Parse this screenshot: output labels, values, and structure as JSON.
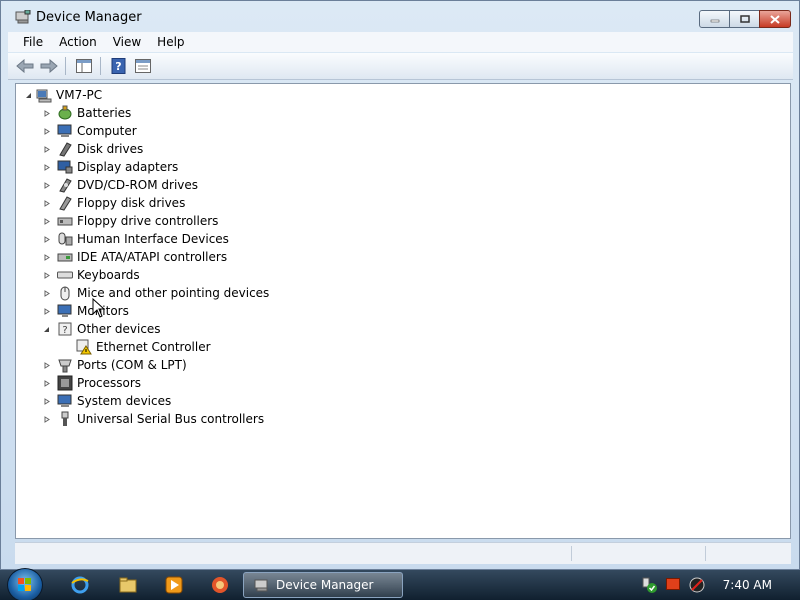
{
  "window": {
    "title": "Device Manager"
  },
  "menu": [
    "File",
    "Action",
    "View",
    "Help"
  ],
  "toolbar": {
    "buttons": [
      "back-arrow-icon",
      "forward-arrow-icon",
      "show-hide-console-tree-icon",
      "help-icon",
      "properties-icon"
    ]
  },
  "tree": {
    "root": "VM7-PC",
    "items": [
      {
        "label": "Batteries",
        "icon": "battery-icon",
        "state": "collapsed"
      },
      {
        "label": "Computer",
        "icon": "computer-icon",
        "state": "collapsed"
      },
      {
        "label": "Disk drives",
        "icon": "disk-drive-icon",
        "state": "collapsed"
      },
      {
        "label": "Display adapters",
        "icon": "display-adapter-icon",
        "state": "collapsed"
      },
      {
        "label": "DVD/CD-ROM drives",
        "icon": "dvd-drive-icon",
        "state": "collapsed"
      },
      {
        "label": "Floppy disk drives",
        "icon": "floppy-drive-icon",
        "state": "collapsed"
      },
      {
        "label": "Floppy drive controllers",
        "icon": "floppy-controller-icon",
        "state": "collapsed"
      },
      {
        "label": "Human Interface Devices",
        "icon": "hid-icon",
        "state": "collapsed"
      },
      {
        "label": "IDE ATA/ATAPI controllers",
        "icon": "ide-controller-icon",
        "state": "collapsed"
      },
      {
        "label": "Keyboards",
        "icon": "keyboard-icon",
        "state": "collapsed"
      },
      {
        "label": "Mice and other pointing devices",
        "icon": "mouse-icon",
        "state": "collapsed"
      },
      {
        "label": "Monitors",
        "icon": "monitor-icon",
        "state": "collapsed"
      },
      {
        "label": "Other devices",
        "icon": "unknown-device-icon",
        "state": "expanded"
      },
      {
        "label": "Ethernet Controller",
        "icon": "warning-device-icon",
        "state": "child"
      },
      {
        "label": "Ports (COM & LPT)",
        "icon": "port-icon",
        "state": "collapsed"
      },
      {
        "label": "Processors",
        "icon": "processor-icon",
        "state": "collapsed"
      },
      {
        "label": "System devices",
        "icon": "system-devices-icon",
        "state": "collapsed"
      },
      {
        "label": "Universal Serial Bus controllers",
        "icon": "usb-icon",
        "state": "collapsed"
      }
    ]
  },
  "taskbar": {
    "active_task": "Device Manager",
    "clock": "7:40 AM"
  }
}
